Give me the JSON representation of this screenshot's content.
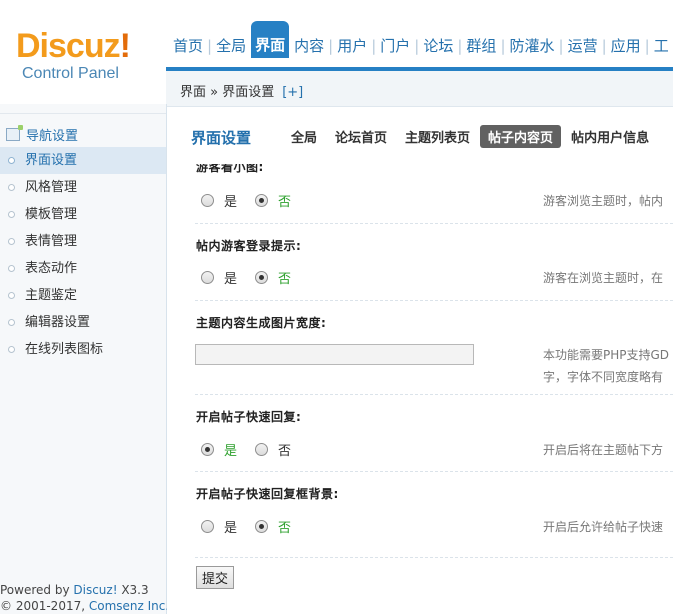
{
  "logo": {
    "name": "Discuz",
    "bang": "!",
    "subtitle": "Control Panel"
  },
  "top_nav": {
    "items": [
      "首页",
      "全局",
      "界面",
      "内容",
      "用户",
      "门户",
      "论坛",
      "群组",
      "防灌水",
      "运营",
      "应用",
      "工"
    ],
    "active_index": 2
  },
  "breadcrumb": {
    "path": "界面 » 界面设置",
    "toggle": "[+]"
  },
  "sidebar": {
    "header": "导航设置",
    "items": [
      "界面设置",
      "风格管理",
      "模板管理",
      "表情管理",
      "表态动作",
      "主题鉴定",
      "编辑器设置",
      "在线列表图标"
    ],
    "active_index": 0,
    "footer_line1_prefix": "Powered by ",
    "footer_line1_highlight": "Discuz!",
    "footer_line1_suffix": " X3.3",
    "footer_line2_prefix": "© 2001-2017, ",
    "footer_line2_highlight": "Comsenz Inc."
  },
  "main": {
    "title": "界面设置",
    "tabs": [
      "全局",
      "论坛首页",
      "主题列表页",
      "帖子内容页",
      "帖内用户信息"
    ],
    "active_tab": 3,
    "settings": [
      {
        "title": "游客看小图:",
        "options": [
          "是",
          "否"
        ],
        "selected": 1,
        "tip": "游客浏览主题时，帖内"
      },
      {
        "title": "帖内游客登录提示:",
        "options": [
          "是",
          "否"
        ],
        "selected": 1,
        "tip": "游客在浏览主题时，在"
      },
      {
        "title": "主题内容生成图片宽度:",
        "input_value": "",
        "tip_line1": "本功能需要PHP支持GD",
        "tip_line2": "字，字体不同宽度略有"
      },
      {
        "title": "开启帖子快速回复:",
        "options": [
          "是",
          "否"
        ],
        "selected": 0,
        "tip": "开启后将在主题帖下方"
      },
      {
        "title": "开启帖子快速回复框背景:",
        "options": [
          "是",
          "否"
        ],
        "selected": 1,
        "tip": "开启后允许给帖子快速"
      }
    ],
    "submit_label": "提交"
  },
  "colors": {
    "accent": "#2680c4",
    "link": "#2571ad",
    "logo_orange": "#f39b1c",
    "selected_green": "#2ea12e"
  }
}
